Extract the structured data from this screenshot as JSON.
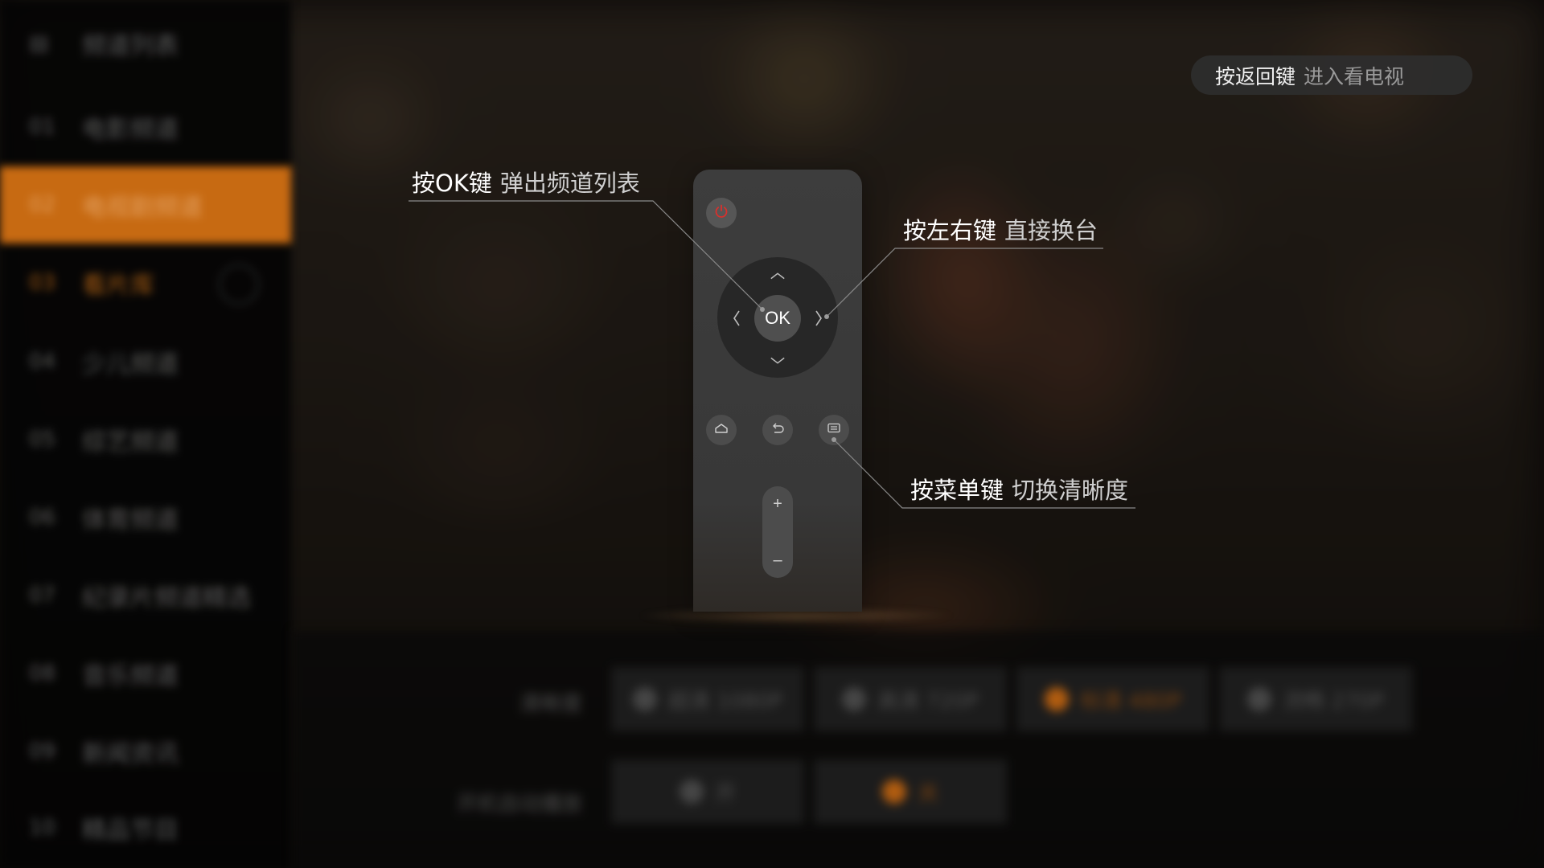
{
  "sidebar": {
    "items": [
      {
        "num": "",
        "label": "频道列表"
      },
      {
        "num": "01",
        "label": "电影频道"
      },
      {
        "num": "02",
        "label": "电视剧频道"
      },
      {
        "num": "03",
        "label": "看片库"
      },
      {
        "num": "04",
        "label": "少儿频道"
      },
      {
        "num": "05",
        "label": "综艺频道"
      },
      {
        "num": "06",
        "label": "体育频道"
      },
      {
        "num": "07",
        "label": "纪录片频道精选"
      },
      {
        "num": "08",
        "label": "音乐频道"
      },
      {
        "num": "09",
        "label": "新闻资讯"
      },
      {
        "num": "10",
        "label": "精品节目"
      }
    ]
  },
  "settings": {
    "clarity_label": "清晰度",
    "clarity_options": [
      "超清 1080P",
      "高清 720P",
      "标清 480P",
      "流畅 270P"
    ],
    "clarity_selected": 2,
    "autoplay_label": "开机自动播放",
    "autoplay_options": [
      "开",
      "关"
    ],
    "autoplay_selected": 1
  },
  "back_hint": {
    "key": "按返回键",
    "action": "进入看电视"
  },
  "callouts": {
    "ok": {
      "key": "按OK键",
      "action": "弹出频道列表"
    },
    "lr": {
      "key": "按左右键",
      "action": "直接换台"
    },
    "menu": {
      "key": "按菜单键",
      "action": "切换清晰度"
    }
  },
  "remote": {
    "ok_label": "OK",
    "vol_plus": "+",
    "vol_minus": "–"
  },
  "colors": {
    "accent": "#c76a12",
    "power_red": "#d9302c"
  }
}
